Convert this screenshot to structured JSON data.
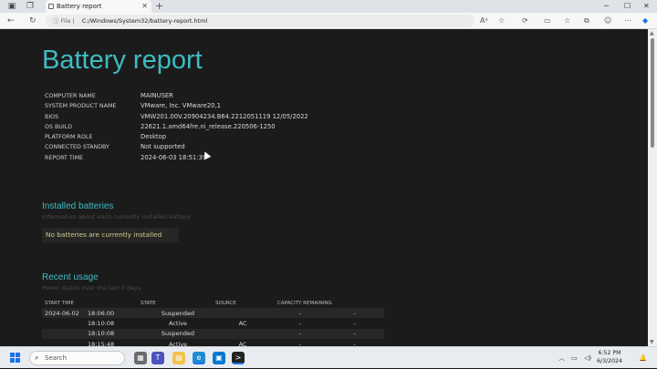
{
  "browser": {
    "tab_title": "Battery report",
    "address_prefix": "File",
    "address_url": "C:/Windows/System32/battery-report.html"
  },
  "report": {
    "title": "Battery report",
    "info": [
      {
        "key": "COMPUTER NAME",
        "value": "MAINUSER"
      },
      {
        "key": "SYSTEM PRODUCT NAME",
        "value": "VMware, Inc. VMware20,1"
      },
      {
        "key": "BIOS",
        "value": "VMW201.00V.20904234.B64.2212051119 12/05/2022"
      },
      {
        "key": "OS BUILD",
        "value": "22621.1.amd64fre.ni_release.220506-1250"
      },
      {
        "key": "PLATFORM ROLE",
        "value": "Desktop"
      },
      {
        "key": "CONNECTED STANDBY",
        "value": "Not supported"
      },
      {
        "key": "REPORT TIME",
        "value": "2024-06-03   18:51:39"
      }
    ],
    "installed": {
      "title": "Installed batteries",
      "subtitle": "Information about each currently installed battery",
      "empty_message": "No batteries are currently installed"
    },
    "recent": {
      "title": "Recent usage",
      "subtitle": "Power states over the last 3 days",
      "headers": {
        "start": "START TIME",
        "state": "STATE",
        "source": "SOURCE",
        "capacity": "CAPACITY REMAINING"
      },
      "rows": [
        {
          "date": "2024-06-02",
          "time": "18:06:00",
          "state": "Suspended",
          "source": "",
          "cap1": "-",
          "cap2": "-"
        },
        {
          "date": "",
          "time": "18:10:08",
          "state": "Active",
          "source": "AC",
          "cap1": "-",
          "cap2": "-"
        },
        {
          "date": "",
          "time": "18:10:08",
          "state": "Suspended",
          "source": "",
          "cap1": "-",
          "cap2": "-"
        },
        {
          "date": "",
          "time": "18:15:48",
          "state": "Active",
          "source": "AC",
          "cap1": "-",
          "cap2": "-"
        }
      ]
    }
  },
  "taskbar": {
    "search_placeholder": "Search",
    "clock_time": "6:52 PM",
    "clock_date": "6/3/2024"
  },
  "colors": {
    "accent": "#3ebcc3",
    "background": "#1b1b1b",
    "highlight_text": "#d0cc8c"
  }
}
